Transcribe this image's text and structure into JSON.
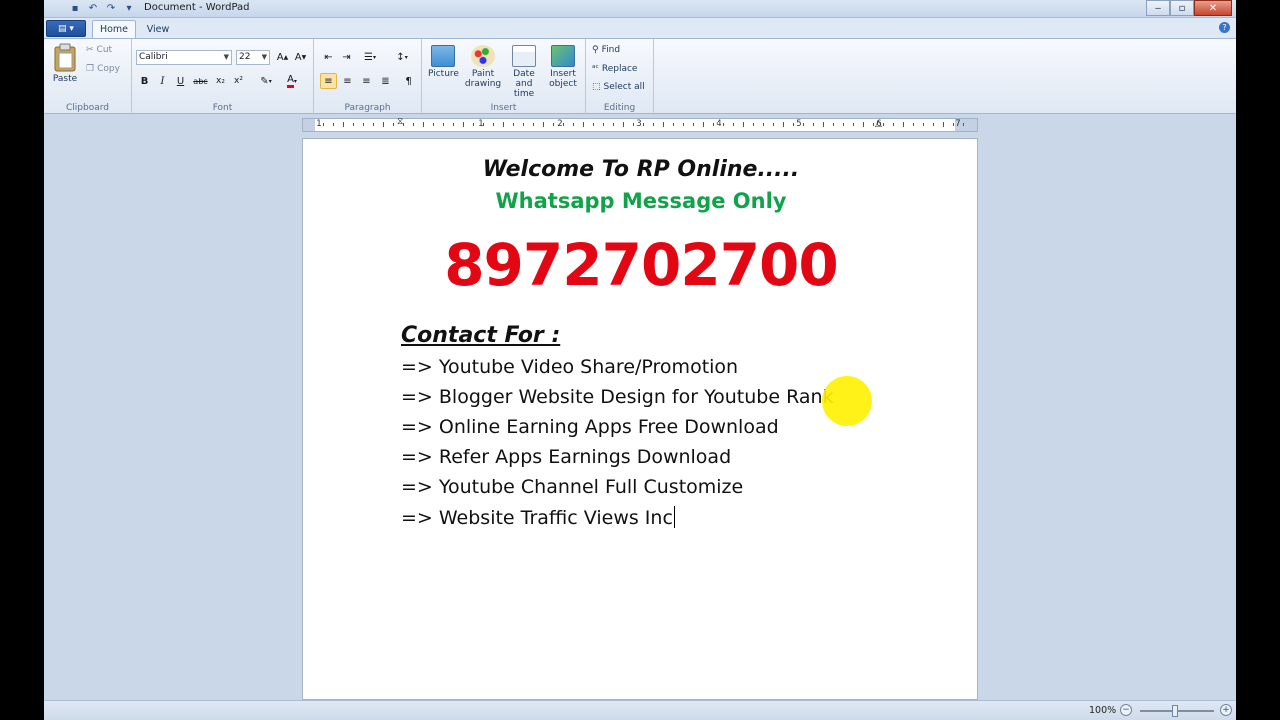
{
  "window": {
    "title": "Document - WordPad"
  },
  "tabs": [
    {
      "label": "Home"
    },
    {
      "label": "View"
    }
  ],
  "ribbon": {
    "clipboard": {
      "paste": "Paste",
      "cut": "Cut",
      "copy": "Copy",
      "label": "Clipboard"
    },
    "font": {
      "family": "Calibri",
      "size": "22",
      "label": "Font"
    },
    "paragraph": {
      "label": "Paragraph"
    },
    "insert": {
      "picture": "Picture",
      "paint_drawing": "Paint drawing",
      "date_time": "Date and time",
      "insert_object": "Insert object",
      "label": "Insert"
    },
    "editing": {
      "find": "Find",
      "replace": "Replace",
      "select_all": "Select all",
      "label": "Editing"
    }
  },
  "ruler": {
    "numbers": [
      "1",
      "1",
      "2",
      "3",
      "4",
      "5",
      "6",
      "7"
    ]
  },
  "document": {
    "heading": "Welcome To RP Online.....",
    "subheading": "Whatsapp Message Only",
    "phone": "8972702700",
    "contact_title": "Contact For :",
    "lines": [
      "=> Youtube Video Share/Promotion",
      "=> Blogger Website Design for Youtube Rank",
      "=> Online Earning Apps Free Download",
      "=> Refer Apps Earnings Download",
      "=> Youtube Channel Full Customize",
      "=> Website Traffic Views Inc"
    ]
  },
  "status": {
    "zoom": "100%"
  },
  "colors": {
    "phone": "#e30613",
    "subheading": "#11a34a",
    "highlight": "#fff100"
  }
}
